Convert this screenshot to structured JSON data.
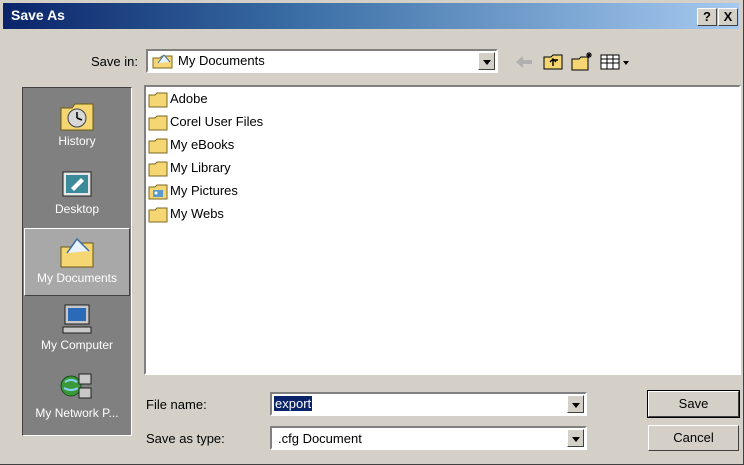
{
  "window": {
    "title": "Save As",
    "help_label": "?",
    "close_label": "X"
  },
  "save_in": {
    "label": "Save in:",
    "value": "My Documents"
  },
  "places": [
    {
      "label": "History",
      "icon": "history-icon"
    },
    {
      "label": "Desktop",
      "icon": "desktop-icon"
    },
    {
      "label": "My Documents",
      "icon": "my-documents-icon"
    },
    {
      "label": "My Computer",
      "icon": "my-computer-icon"
    },
    {
      "label": "My Network P...",
      "icon": "network-places-icon"
    }
  ],
  "files": [
    {
      "name": "Adobe",
      "icon": "folder-icon"
    },
    {
      "name": "Corel User Files",
      "icon": "folder-icon"
    },
    {
      "name": "My eBooks",
      "icon": "folder-icon"
    },
    {
      "name": "My Library",
      "icon": "folder-icon"
    },
    {
      "name": "My Pictures",
      "icon": "pictures-folder-icon"
    },
    {
      "name": "My Webs",
      "icon": "folder-icon"
    }
  ],
  "file_name": {
    "label": "File name:",
    "value": "export"
  },
  "save_type": {
    "label": "Save as type:",
    "value": ".cfg Document"
  },
  "buttons": {
    "save": "Save",
    "cancel": "Cancel"
  },
  "colors": {
    "title_start": "#0a246a",
    "title_end": "#a6caf0",
    "face": "#d4d0c8",
    "places_bg": "#808080",
    "folder": "#f5d673"
  }
}
